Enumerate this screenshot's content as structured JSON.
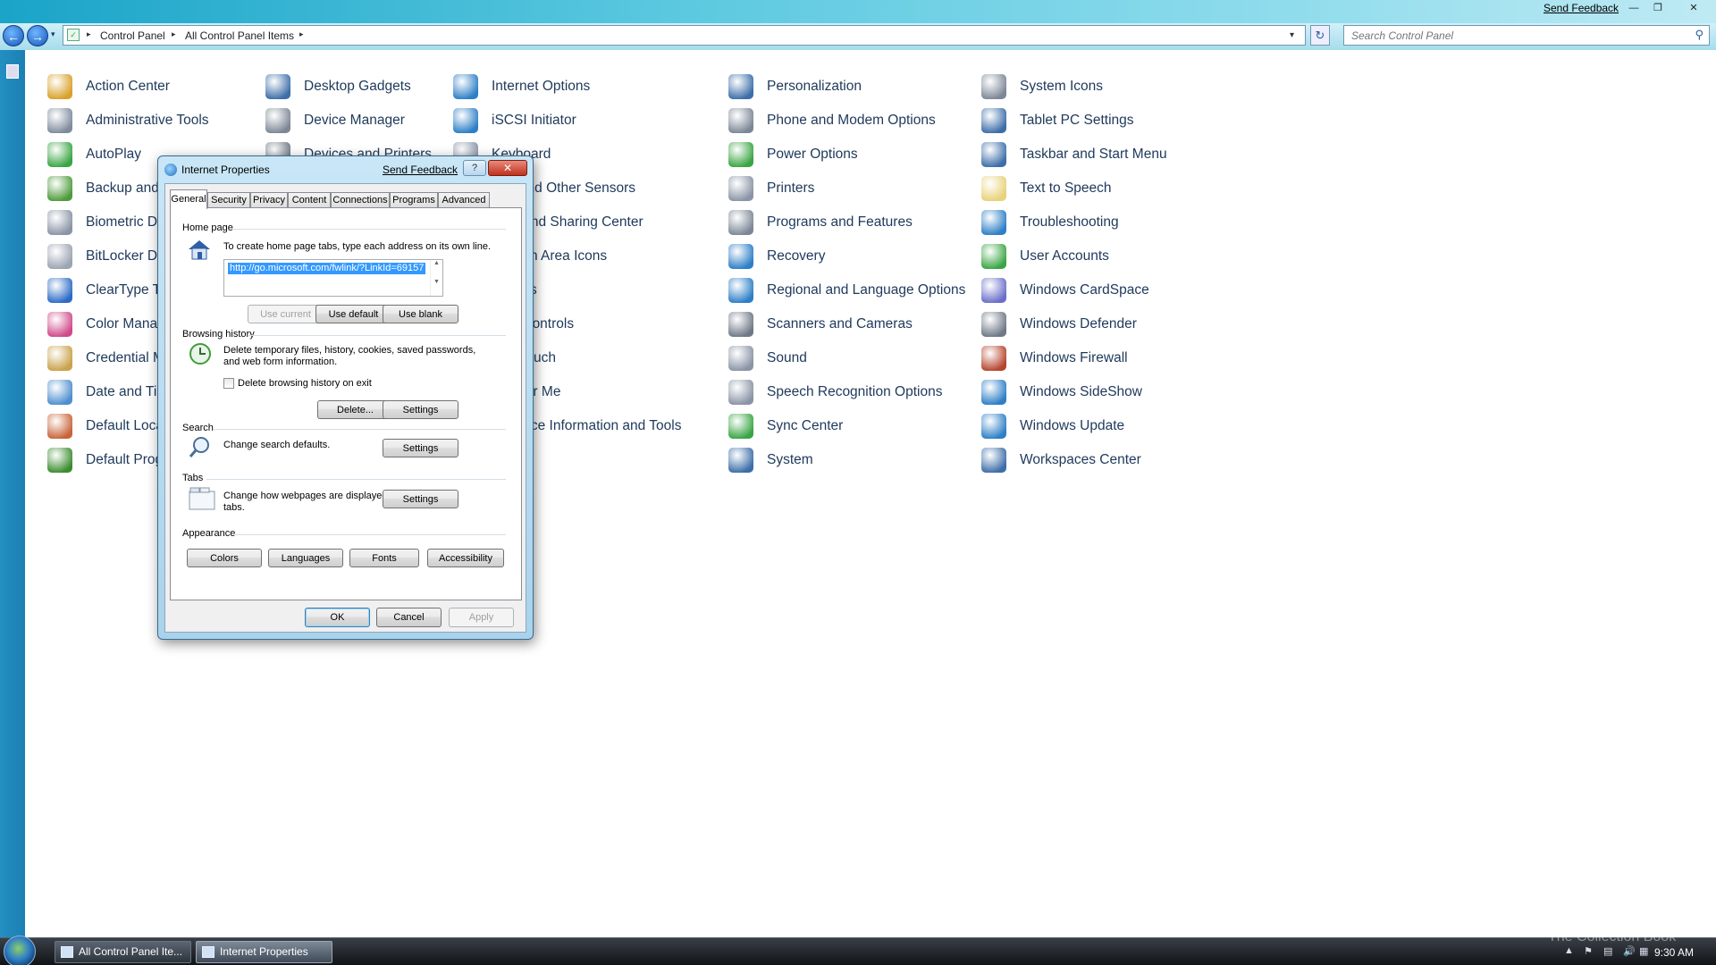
{
  "window": {
    "send_feedback": "Send Feedback",
    "minimize": "—",
    "maximize": "❐",
    "close": "✕"
  },
  "address": {
    "back_glyph": "←",
    "forward_glyph": "→",
    "history_glyph": "▾",
    "crumbs": [
      "Control Panel",
      "All Control Panel Items"
    ],
    "separator": "▸",
    "dropdown_glyph": "▾",
    "refresh_glyph": "↻",
    "search_placeholder": "Search Control Panel",
    "search_glyph": "⚲"
  },
  "control_panel": {
    "items": [
      {
        "label": "Action Center",
        "icon": "shield-flag-icon",
        "color": "#d9a12a"
      },
      {
        "label": "Administrative Tools",
        "icon": "admin-tools-icon",
        "color": "#7f8b9c"
      },
      {
        "label": "AutoPlay",
        "icon": "autoplay-icon",
        "color": "#3aa544"
      },
      {
        "label": "Backup and",
        "icon": "backup-icon",
        "color": "#4e9b3c"
      },
      {
        "label": "Biometric D",
        "icon": "fingerprint-icon",
        "color": "#8a94a6"
      },
      {
        "label": "BitLocker D",
        "icon": "bitlocker-icon",
        "color": "#9aa4b2"
      },
      {
        "label": "ClearType T",
        "icon": "cleartype-icon",
        "color": "#2b6bc7"
      },
      {
        "label": "Color Mana",
        "icon": "color-management-icon",
        "color": "#d04a8a"
      },
      {
        "label": "Credential M",
        "icon": "credential-icon",
        "color": "#c9a24a"
      },
      {
        "label": "Date and Ti",
        "icon": "calendar-clock-icon",
        "color": "#4e8fcf"
      },
      {
        "label": "Default Loca",
        "icon": "location-icon",
        "color": "#c8643a"
      },
      {
        "label": "Default Prog",
        "icon": "default-programs-icon",
        "color": "#3c8d2f"
      },
      {
        "label": "Desktop Gadgets",
        "icon": "gadgets-icon",
        "color": "#3d6ea8"
      },
      {
        "label": "Device Manager",
        "icon": "device-manager-icon",
        "color": "#7c8796"
      },
      {
        "label": "Devices and Printers",
        "icon": "devices-printers-icon",
        "color": "#6e7886"
      },
      {
        "label": "Internet Options",
        "icon": "internet-options-icon",
        "color": "#2d7fc6"
      },
      {
        "label": "iSCSI Initiator",
        "icon": "iscsi-icon",
        "color": "#2d7fc6"
      },
      {
        "label": "Keyboard",
        "icon": "keyboard-icon",
        "color": "#8a94a6"
      },
      {
        "label": "n and Other Sensors",
        "icon": "sensor-icon",
        "color": "#6e7886"
      },
      {
        "label": "rk and Sharing Center",
        "icon": "network-icon",
        "color": "#2d7fc6"
      },
      {
        "label": "ation Area Icons",
        "icon": "tray-icon",
        "color": "#6e7886"
      },
      {
        "label": "Files",
        "icon": "offline-files-icon",
        "color": "#3aa544"
      },
      {
        "label": "al Controls",
        "icon": "parental-icon",
        "color": "#c8643a"
      },
      {
        "label": "d Touch",
        "icon": "pen-touch-icon",
        "color": "#6e7886"
      },
      {
        "label": "Near Me",
        "icon": "people-near-me-icon",
        "color": "#3d6ea8"
      },
      {
        "label": "nance Information and Tools",
        "icon": "performance-icon",
        "color": "#3aa544"
      },
      {
        "label": "Personalization",
        "icon": "personalization-icon",
        "color": "#3d6ea8"
      },
      {
        "label": "Phone and Modem Options",
        "icon": "phone-modem-icon",
        "color": "#7c8796"
      },
      {
        "label": "Power Options",
        "icon": "power-icon",
        "color": "#3aa544"
      },
      {
        "label": "Printers",
        "icon": "printer-icon",
        "color": "#8a94a6"
      },
      {
        "label": "Programs and Features",
        "icon": "programs-icon",
        "color": "#7c8796"
      },
      {
        "label": "Recovery",
        "icon": "recovery-icon",
        "color": "#2d7fc6"
      },
      {
        "label": "Regional and Language Options",
        "icon": "globe-icon",
        "color": "#2d7fc6"
      },
      {
        "label": "Scanners and Cameras",
        "icon": "scanner-icon",
        "color": "#6e7886"
      },
      {
        "label": "Sound",
        "icon": "speaker-icon",
        "color": "#8a94a6"
      },
      {
        "label": "Speech Recognition Options",
        "icon": "microphone-icon",
        "color": "#8a94a6"
      },
      {
        "label": "Sync Center",
        "icon": "sync-icon",
        "color": "#3aa544"
      },
      {
        "label": "System",
        "icon": "computer-icon",
        "color": "#3d6ea8"
      },
      {
        "label": "System Icons",
        "icon": "system-icons-icon",
        "color": "#7c8796"
      },
      {
        "label": "Tablet PC Settings",
        "icon": "tablet-icon",
        "color": "#3d6ea8"
      },
      {
        "label": "Taskbar and Start Menu",
        "icon": "taskbar-icon",
        "color": "#3d6ea8"
      },
      {
        "label": "Text to Speech",
        "icon": "speech-bubble-icon",
        "color": "#e8d27a"
      },
      {
        "label": "Troubleshooting",
        "icon": "troubleshooting-icon",
        "color": "#2d7fc6"
      },
      {
        "label": "User Accounts",
        "icon": "user-accounts-icon",
        "color": "#3aa544"
      },
      {
        "label": "Windows CardSpace",
        "icon": "cardspace-icon",
        "color": "#6a6fc9"
      },
      {
        "label": "Windows Defender",
        "icon": "defender-icon",
        "color": "#6e7886"
      },
      {
        "label": "Windows Firewall",
        "icon": "firewall-icon",
        "color": "#b5452e"
      },
      {
        "label": "Windows SideShow",
        "icon": "sideshow-icon",
        "color": "#2d7fc6"
      },
      {
        "label": "Windows Update",
        "icon": "windows-update-icon",
        "color": "#2d7fc6"
      },
      {
        "label": "Workspaces Center",
        "icon": "workspaces-icon",
        "color": "#3d6ea8"
      }
    ]
  },
  "dialog": {
    "title": "Internet Properties",
    "send_feedback": "Send Feedback",
    "help": "?",
    "close": "✕",
    "tabs": [
      "General",
      "Security",
      "Privacy",
      "Content",
      "Connections",
      "Programs",
      "Advanced"
    ],
    "home_page": {
      "heading": "Home page",
      "instructions": "To create home page tabs, type each address on its own line.",
      "url": "http://go.microsoft.com/fwlink/?LinkId=69157",
      "use_current": "Use current",
      "use_default": "Use default",
      "use_blank": "Use blank"
    },
    "browsing_history": {
      "heading": "Browsing history",
      "description": "Delete temporary files, history, cookies, saved passwords, and web form information.",
      "delete_on_exit": "Delete browsing history on exit",
      "delete_on_exit_checked": false,
      "delete_button": "Delete...",
      "settings_button": "Settings"
    },
    "search": {
      "heading": "Search",
      "description": "Change search defaults.",
      "settings_button": "Settings"
    },
    "tabs_section": {
      "heading": "Tabs",
      "description": "Change how webpages are displayed in tabs.",
      "settings_button": "Settings"
    },
    "appearance": {
      "heading": "Appearance",
      "colors": "Colors",
      "languages": "Languages",
      "fonts": "Fonts",
      "accessibility": "Accessibility"
    },
    "ok": "OK",
    "cancel": "Cancel",
    "apply": "Apply"
  },
  "taskbar": {
    "tasks": [
      "All Control Panel Ite...",
      "Internet Properties"
    ],
    "tray_glyphs": [
      "▲",
      "⚑",
      "▤",
      "🔊",
      "▦"
    ],
    "clock": "9:30 AM",
    "watermark": "The Collection Book"
  }
}
